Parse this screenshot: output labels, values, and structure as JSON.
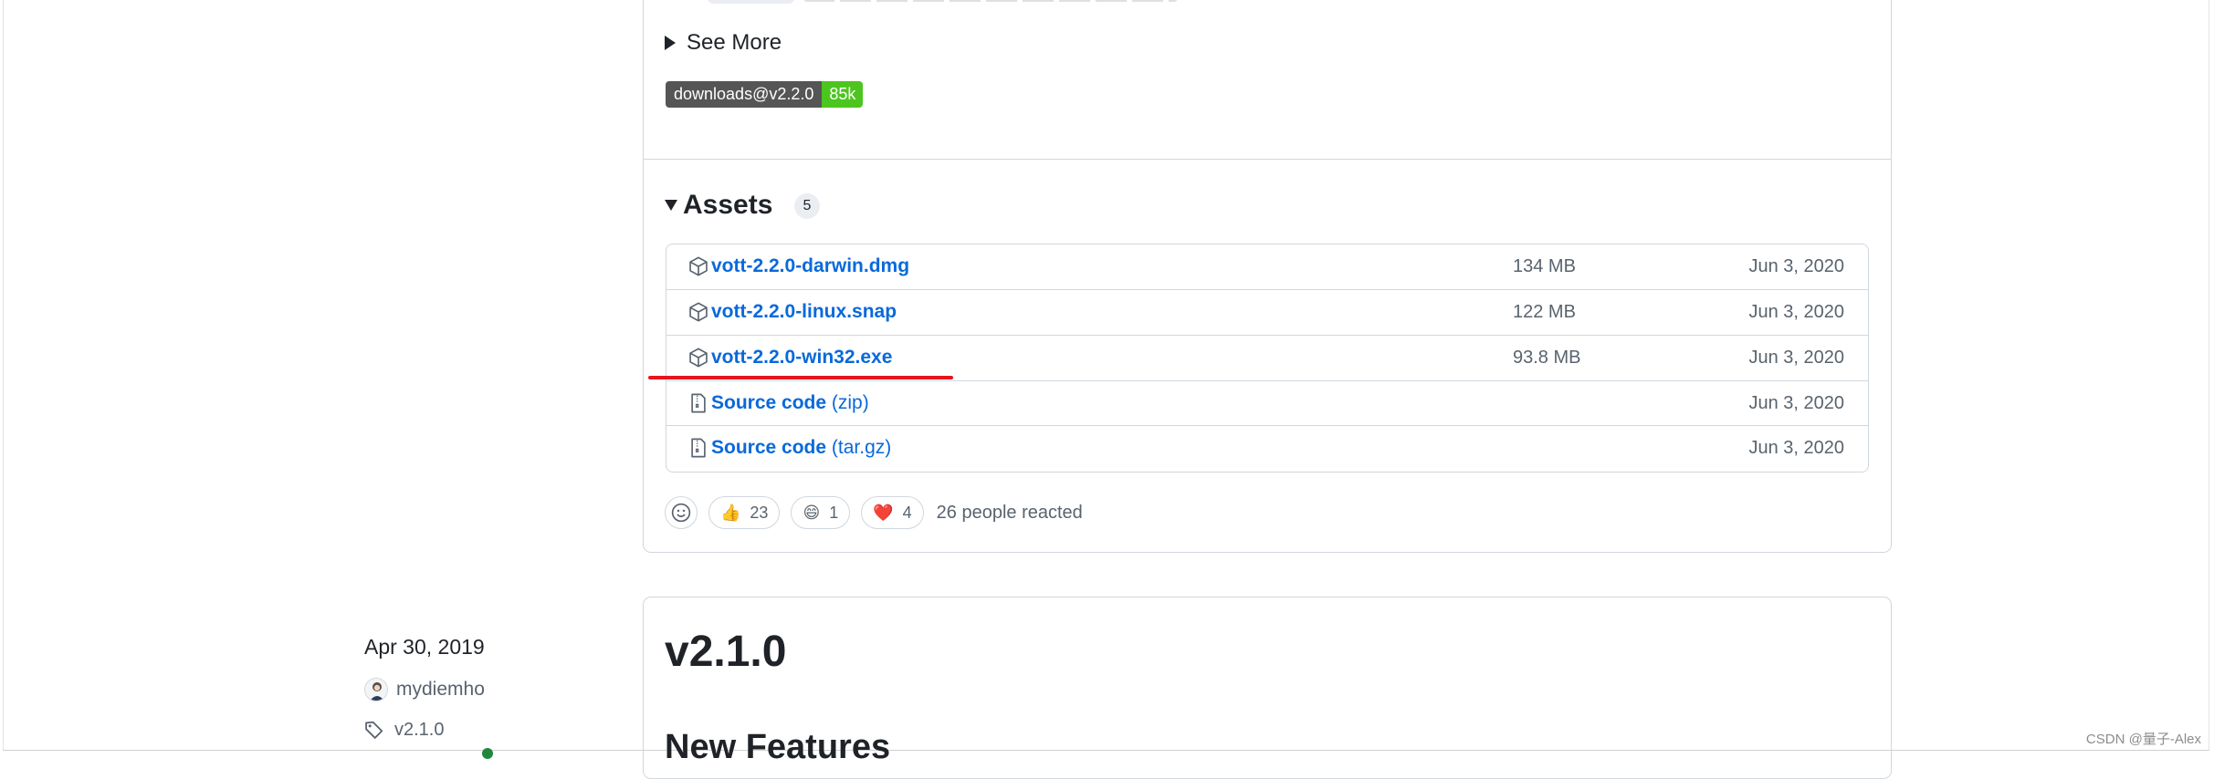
{
  "release_current": {
    "see_more": "See More",
    "badge": {
      "label": "downloads@v2.2.0",
      "value": "85k",
      "colors": {
        "label_bg": "#555555",
        "value_bg": "#4cc61e"
      }
    },
    "assets": {
      "title": "Assets",
      "count": "5",
      "items": [
        {
          "name": "vott-2.2.0-darwin.dmg",
          "suffix": "",
          "size": "134 MB",
          "date": "Jun 3, 2020",
          "icon": "package-icon"
        },
        {
          "name": "vott-2.2.0-linux.snap",
          "suffix": "",
          "size": "122 MB",
          "date": "Jun 3, 2020",
          "icon": "package-icon"
        },
        {
          "name": "vott-2.2.0-win32.exe",
          "suffix": "",
          "size": "93.8 MB",
          "date": "Jun 3, 2020",
          "icon": "package-icon"
        },
        {
          "name": "Source code",
          "suffix": "(zip)",
          "size": "",
          "date": "Jun 3, 2020",
          "icon": "file-zip-icon"
        },
        {
          "name": "Source code",
          "suffix": "(tar.gz)",
          "size": "",
          "date": "Jun 3, 2020",
          "icon": "file-zip-icon"
        }
      ]
    },
    "reactions": {
      "items": [
        {
          "emoji": "👍",
          "count": "23"
        },
        {
          "emoji": "😄",
          "count": "1"
        },
        {
          "emoji": "❤️",
          "count": "4"
        }
      ],
      "summary": "26 people reacted"
    }
  },
  "release_next": {
    "date": "Apr 30, 2019",
    "author": "mydiemho",
    "tag": "v2.1.0",
    "title": "v2.1.0",
    "section_heading": "New Features"
  },
  "watermark": "CSDN @量子-Alex",
  "colors": {
    "link": "#0969da",
    "annotation": "#e8141c",
    "border": "#d0d7de"
  }
}
